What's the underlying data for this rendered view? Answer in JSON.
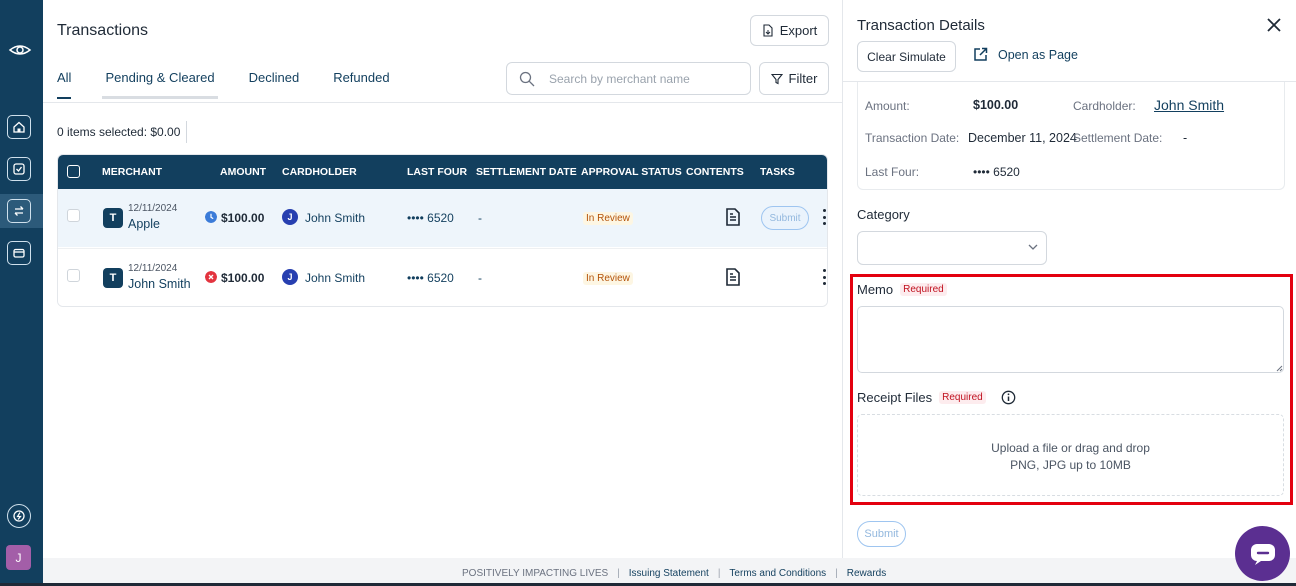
{
  "main": {
    "title": "Transactions",
    "export_label": "Export",
    "tabs": [
      {
        "label": "All"
      },
      {
        "label": "Pending & Cleared"
      },
      {
        "label": "Declined"
      },
      {
        "label": "Refunded"
      }
    ],
    "search_placeholder": "Search by merchant name",
    "filter_label": "Filter",
    "selected_info": "0 items selected: $0.00"
  },
  "table": {
    "headers": {
      "merchant": "MERCHANT",
      "amount": "AMOUNT",
      "cardholder": "CARDHOLDER",
      "last_four": "LAST FOUR",
      "settlement_date": "SETTLEMENT DATE",
      "approval_status": "APPROVAL STATUS",
      "contents": "CONTENTS",
      "tasks": "TASKS"
    },
    "rows": [
      {
        "merchant_initial": "T",
        "date": "12/11/2024",
        "merchant": "Apple",
        "amount_status_icon": "clock-icon",
        "amount_status_color": "#3b7bd8",
        "amount": "$100.00",
        "cardholder_initial": "J",
        "cardholder": "John Smith",
        "last_four": "•••• 6520",
        "settlement_date": "-",
        "approval_status": "In Review",
        "task": "Submit"
      },
      {
        "merchant_initial": "T",
        "date": "12/11/2024",
        "merchant": "John Smith",
        "amount_status_icon": "x-circle-icon",
        "amount_status_color": "#e3343f",
        "amount": "$100.00",
        "cardholder_initial": "J",
        "cardholder": "John Smith",
        "last_four": "•••• 6520",
        "settlement_date": "-",
        "approval_status": "In Review",
        "task": ""
      }
    ]
  },
  "panel": {
    "title": "Transaction Details",
    "clear_label": "Clear Simulate",
    "open_page_label": "Open as Page",
    "amount_label": "Amount:",
    "amount_value": "$100.00",
    "cardholder_label": "Cardholder:",
    "cardholder_value": "John Smith",
    "date_label": "Transaction Date:",
    "date_value": "December 11, 2024",
    "settlement_label": "Settlement Date:",
    "settlement_value": "-",
    "last_four_label": "Last Four:",
    "last_four_value": "•••• 6520",
    "category_label": "Category",
    "memo_label": "Memo",
    "receipt_label": "Receipt Files",
    "required_tag": "Required",
    "upload_line1": "Upload a file or drag and drop",
    "upload_line2": "PNG, JPG up to 10MB",
    "submit_label": "Submit"
  },
  "rail": {
    "avatar_initial": "J"
  },
  "footer": {
    "tagline": "POSITIVELY IMPACTING LIVES",
    "links": [
      "Issuing Statement",
      "Terms and Conditions",
      "Rewards"
    ]
  },
  "colors": {
    "brand_navy": "#123f5e",
    "required_red": "#c0111f",
    "highlight_red": "#e3000f",
    "chat_purple": "#5b2f91"
  }
}
